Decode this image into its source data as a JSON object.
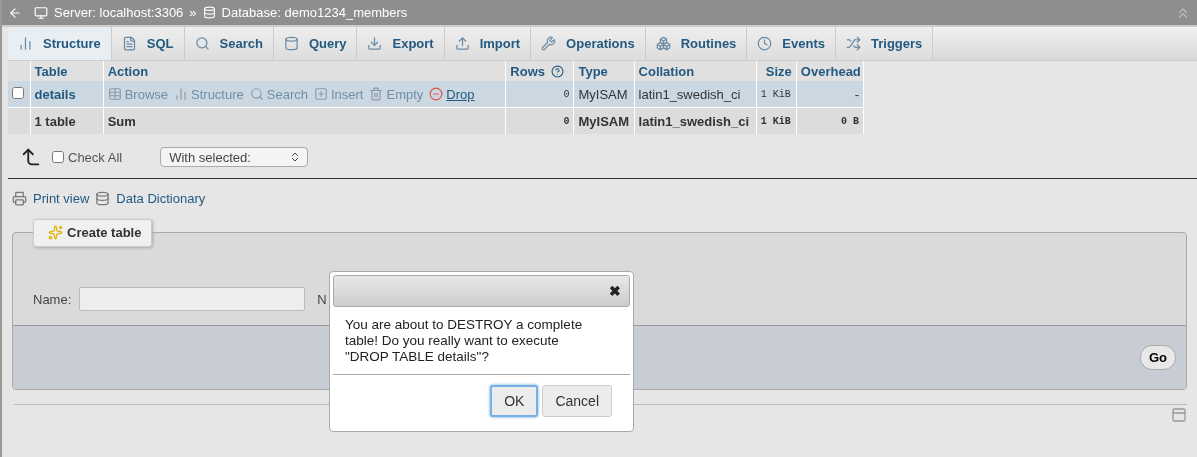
{
  "breadcrumb": {
    "server": "Server: localhost:3306",
    "separator": "»",
    "database": "Database: demo1234_members"
  },
  "tabs": [
    {
      "label": "Structure",
      "selected": true
    },
    {
      "label": "SQL",
      "selected": false
    },
    {
      "label": "Search",
      "selected": false
    },
    {
      "label": "Query",
      "selected": false
    },
    {
      "label": "Export",
      "selected": false
    },
    {
      "label": "Import",
      "selected": false
    },
    {
      "label": "Operations",
      "selected": false
    },
    {
      "label": "Routines",
      "selected": false
    },
    {
      "label": "Events",
      "selected": false
    },
    {
      "label": "Triggers",
      "selected": false
    }
  ],
  "table": {
    "columns": [
      "Table",
      "Action",
      "Rows",
      "Type",
      "Collation",
      "Size",
      "Overhead"
    ],
    "rows": [
      {
        "checked": false,
        "name": "details",
        "actions": [
          {
            "label": "Browse",
            "disabled": true
          },
          {
            "label": "Structure",
            "disabled": true
          },
          {
            "label": "Search",
            "disabled": true
          },
          {
            "label": "Insert",
            "disabled": true
          },
          {
            "label": "Empty",
            "disabled": true
          },
          {
            "label": "Drop",
            "disabled": false
          }
        ],
        "rows": "0",
        "type": "MyISAM",
        "collation": "latin1_swedish_ci",
        "size": "1 KiB",
        "overhead": "-"
      }
    ],
    "footer": [
      "1 table",
      "Sum",
      "0",
      "MyISAM",
      "latin1_swedish_ci",
      "1 KiB",
      "0 B"
    ]
  },
  "check_all": {
    "label": "Check All",
    "checked": false
  },
  "with_selected": "With selected:",
  "links": [
    "Print view",
    "Data Dictionary"
  ],
  "create_table": {
    "legend": "Create table",
    "name_label": "Name:",
    "covered_label": "N",
    "go": "Go"
  },
  "dialog": {
    "message": "You are about to DESTROY a complete table! Do you really want to execute \"DROP TABLE details\"?",
    "close": "✖",
    "buttons": [
      {
        "label": "OK",
        "focused": true
      },
      {
        "label": "Cancel",
        "focused": false
      }
    ]
  }
}
